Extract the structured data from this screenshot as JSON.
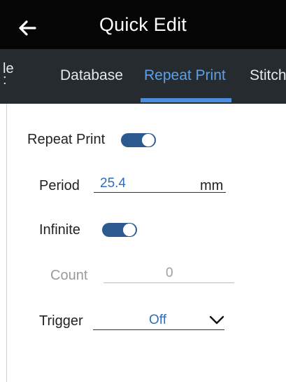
{
  "header": {
    "title": "Quick Edit",
    "back_icon": "arrow-left-icon"
  },
  "tabs": [
    {
      "label": "le\n:",
      "active": false
    },
    {
      "label": "Database",
      "active": false
    },
    {
      "label": "Repeat Print",
      "active": true
    },
    {
      "label": "Stitch",
      "active": false
    }
  ],
  "form": {
    "repeat_print": {
      "label": "Repeat Print",
      "on": true
    },
    "period": {
      "label": "Period",
      "value": "25.4",
      "unit": "mm"
    },
    "infinite": {
      "label": "Infinite",
      "on": true
    },
    "count": {
      "label": "Count",
      "value": "0",
      "enabled": false
    },
    "trigger": {
      "label": "Trigger",
      "value": "Off",
      "icon": "chevron-down-icon"
    }
  },
  "colors": {
    "header_bg": "#050505",
    "tabs_bg": "#262b2f",
    "accent": "#4a8fdd",
    "toggle_on": "#2c5a8e",
    "value_blue": "#2f6ebc"
  }
}
